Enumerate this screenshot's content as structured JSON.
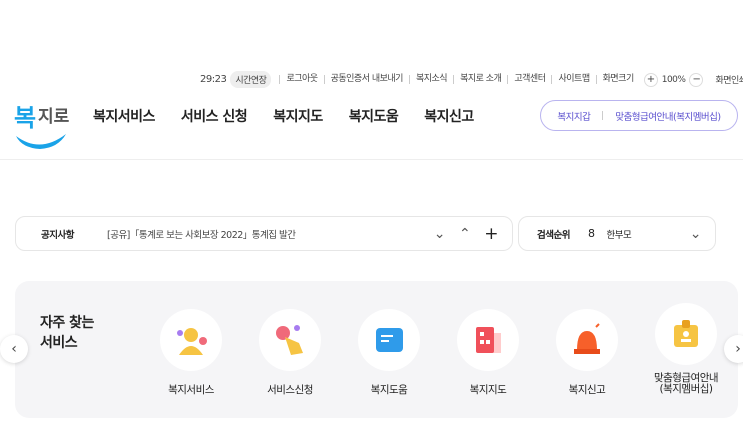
{
  "utility": {
    "timer": "29:23",
    "extend": "시간연장",
    "links": [
      "로그아웃",
      "공동인증서 내보내기",
      "복지소식",
      "복지로 소개",
      "고객센터",
      "사이트맵",
      "화면크기"
    ],
    "zoom_in": "+",
    "zoom": "100%",
    "zoom_out": "−",
    "print": "화면인쇄"
  },
  "logo": {
    "text": "복지로",
    "color": "#1aa3e8"
  },
  "nav": [
    "복지서비스",
    "서비스 신청",
    "복지지도",
    "복지도움",
    "복지신고"
  ],
  "pill": {
    "left": "복지지갑",
    "right": "맞춤형급여안내(복지멤버십)"
  },
  "notice": {
    "label": "공지사항",
    "text": "[공유]「통계로 보는 사회보장 2022」통계집 발간",
    "down": "⌄",
    "up": "⌃",
    "plus": "+"
  },
  "rank": {
    "label": "검색순위",
    "number": "8",
    "keyword": "한부모",
    "toggle": "⌄"
  },
  "services": {
    "title_line1": "자주 찾는",
    "title_line2": "서비스",
    "items": [
      {
        "label": "복지서비스",
        "icon": "person-icon",
        "color": "#f6c443"
      },
      {
        "label": "서비스신청",
        "icon": "hand-pointer-icon",
        "color": "#f6c443"
      },
      {
        "label": "복지도움",
        "icon": "memo-icon",
        "color": "#2f9bea"
      },
      {
        "label": "복지지도",
        "icon": "building-icon",
        "color": "#f0505a"
      },
      {
        "label": "복지신고",
        "icon": "siren-icon",
        "color": "#f7602a"
      },
      {
        "label": "맞춤형급여안내",
        "label2": "(복지멤버십)",
        "icon": "id-card-icon",
        "color": "#f6c443"
      }
    ],
    "prev": "‹",
    "next": "›"
  }
}
